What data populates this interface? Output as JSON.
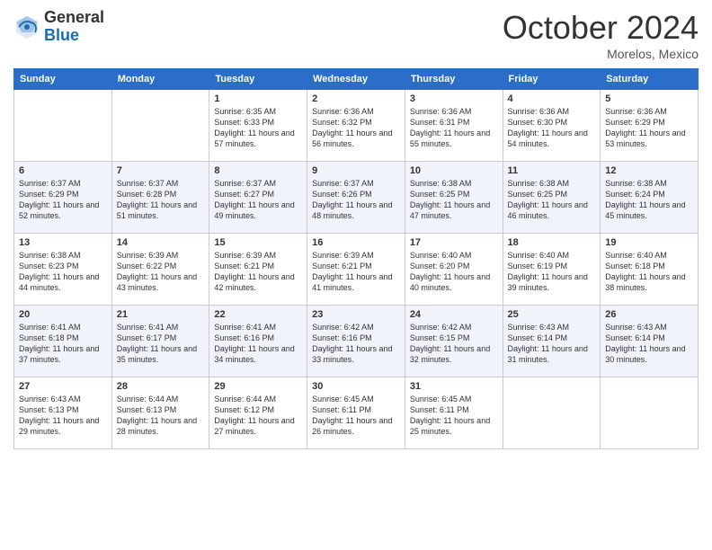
{
  "header": {
    "logo_general": "General",
    "logo_blue": "Blue",
    "month_title": "October 2024",
    "location": "Morelos, Mexico"
  },
  "weekdays": [
    "Sunday",
    "Monday",
    "Tuesday",
    "Wednesday",
    "Thursday",
    "Friday",
    "Saturday"
  ],
  "weeks": [
    [
      {
        "day": "",
        "sunrise": "",
        "sunset": "",
        "daylight": ""
      },
      {
        "day": "",
        "sunrise": "",
        "sunset": "",
        "daylight": ""
      },
      {
        "day": "1",
        "sunrise": "Sunrise: 6:35 AM",
        "sunset": "Sunset: 6:33 PM",
        "daylight": "Daylight: 11 hours and 57 minutes."
      },
      {
        "day": "2",
        "sunrise": "Sunrise: 6:36 AM",
        "sunset": "Sunset: 6:32 PM",
        "daylight": "Daylight: 11 hours and 56 minutes."
      },
      {
        "day": "3",
        "sunrise": "Sunrise: 6:36 AM",
        "sunset": "Sunset: 6:31 PM",
        "daylight": "Daylight: 11 hours and 55 minutes."
      },
      {
        "day": "4",
        "sunrise": "Sunrise: 6:36 AM",
        "sunset": "Sunset: 6:30 PM",
        "daylight": "Daylight: 11 hours and 54 minutes."
      },
      {
        "day": "5",
        "sunrise": "Sunrise: 6:36 AM",
        "sunset": "Sunset: 6:29 PM",
        "daylight": "Daylight: 11 hours and 53 minutes."
      }
    ],
    [
      {
        "day": "6",
        "sunrise": "Sunrise: 6:37 AM",
        "sunset": "Sunset: 6:29 PM",
        "daylight": "Daylight: 11 hours and 52 minutes."
      },
      {
        "day": "7",
        "sunrise": "Sunrise: 6:37 AM",
        "sunset": "Sunset: 6:28 PM",
        "daylight": "Daylight: 11 hours and 51 minutes."
      },
      {
        "day": "8",
        "sunrise": "Sunrise: 6:37 AM",
        "sunset": "Sunset: 6:27 PM",
        "daylight": "Daylight: 11 hours and 49 minutes."
      },
      {
        "day": "9",
        "sunrise": "Sunrise: 6:37 AM",
        "sunset": "Sunset: 6:26 PM",
        "daylight": "Daylight: 11 hours and 48 minutes."
      },
      {
        "day": "10",
        "sunrise": "Sunrise: 6:38 AM",
        "sunset": "Sunset: 6:25 PM",
        "daylight": "Daylight: 11 hours and 47 minutes."
      },
      {
        "day": "11",
        "sunrise": "Sunrise: 6:38 AM",
        "sunset": "Sunset: 6:25 PM",
        "daylight": "Daylight: 11 hours and 46 minutes."
      },
      {
        "day": "12",
        "sunrise": "Sunrise: 6:38 AM",
        "sunset": "Sunset: 6:24 PM",
        "daylight": "Daylight: 11 hours and 45 minutes."
      }
    ],
    [
      {
        "day": "13",
        "sunrise": "Sunrise: 6:38 AM",
        "sunset": "Sunset: 6:23 PM",
        "daylight": "Daylight: 11 hours and 44 minutes."
      },
      {
        "day": "14",
        "sunrise": "Sunrise: 6:39 AM",
        "sunset": "Sunset: 6:22 PM",
        "daylight": "Daylight: 11 hours and 43 minutes."
      },
      {
        "day": "15",
        "sunrise": "Sunrise: 6:39 AM",
        "sunset": "Sunset: 6:21 PM",
        "daylight": "Daylight: 11 hours and 42 minutes."
      },
      {
        "day": "16",
        "sunrise": "Sunrise: 6:39 AM",
        "sunset": "Sunset: 6:21 PM",
        "daylight": "Daylight: 11 hours and 41 minutes."
      },
      {
        "day": "17",
        "sunrise": "Sunrise: 6:40 AM",
        "sunset": "Sunset: 6:20 PM",
        "daylight": "Daylight: 11 hours and 40 minutes."
      },
      {
        "day": "18",
        "sunrise": "Sunrise: 6:40 AM",
        "sunset": "Sunset: 6:19 PM",
        "daylight": "Daylight: 11 hours and 39 minutes."
      },
      {
        "day": "19",
        "sunrise": "Sunrise: 6:40 AM",
        "sunset": "Sunset: 6:18 PM",
        "daylight": "Daylight: 11 hours and 38 minutes."
      }
    ],
    [
      {
        "day": "20",
        "sunrise": "Sunrise: 6:41 AM",
        "sunset": "Sunset: 6:18 PM",
        "daylight": "Daylight: 11 hours and 37 minutes."
      },
      {
        "day": "21",
        "sunrise": "Sunrise: 6:41 AM",
        "sunset": "Sunset: 6:17 PM",
        "daylight": "Daylight: 11 hours and 35 minutes."
      },
      {
        "day": "22",
        "sunrise": "Sunrise: 6:41 AM",
        "sunset": "Sunset: 6:16 PM",
        "daylight": "Daylight: 11 hours and 34 minutes."
      },
      {
        "day": "23",
        "sunrise": "Sunrise: 6:42 AM",
        "sunset": "Sunset: 6:16 PM",
        "daylight": "Daylight: 11 hours and 33 minutes."
      },
      {
        "day": "24",
        "sunrise": "Sunrise: 6:42 AM",
        "sunset": "Sunset: 6:15 PM",
        "daylight": "Daylight: 11 hours and 32 minutes."
      },
      {
        "day": "25",
        "sunrise": "Sunrise: 6:43 AM",
        "sunset": "Sunset: 6:14 PM",
        "daylight": "Daylight: 11 hours and 31 minutes."
      },
      {
        "day": "26",
        "sunrise": "Sunrise: 6:43 AM",
        "sunset": "Sunset: 6:14 PM",
        "daylight": "Daylight: 11 hours and 30 minutes."
      }
    ],
    [
      {
        "day": "27",
        "sunrise": "Sunrise: 6:43 AM",
        "sunset": "Sunset: 6:13 PM",
        "daylight": "Daylight: 11 hours and 29 minutes."
      },
      {
        "day": "28",
        "sunrise": "Sunrise: 6:44 AM",
        "sunset": "Sunset: 6:13 PM",
        "daylight": "Daylight: 11 hours and 28 minutes."
      },
      {
        "day": "29",
        "sunrise": "Sunrise: 6:44 AM",
        "sunset": "Sunset: 6:12 PM",
        "daylight": "Daylight: 11 hours and 27 minutes."
      },
      {
        "day": "30",
        "sunrise": "Sunrise: 6:45 AM",
        "sunset": "Sunset: 6:11 PM",
        "daylight": "Daylight: 11 hours and 26 minutes."
      },
      {
        "day": "31",
        "sunrise": "Sunrise: 6:45 AM",
        "sunset": "Sunset: 6:11 PM",
        "daylight": "Daylight: 11 hours and 25 minutes."
      },
      {
        "day": "",
        "sunrise": "",
        "sunset": "",
        "daylight": ""
      },
      {
        "day": "",
        "sunrise": "",
        "sunset": "",
        "daylight": ""
      }
    ]
  ]
}
